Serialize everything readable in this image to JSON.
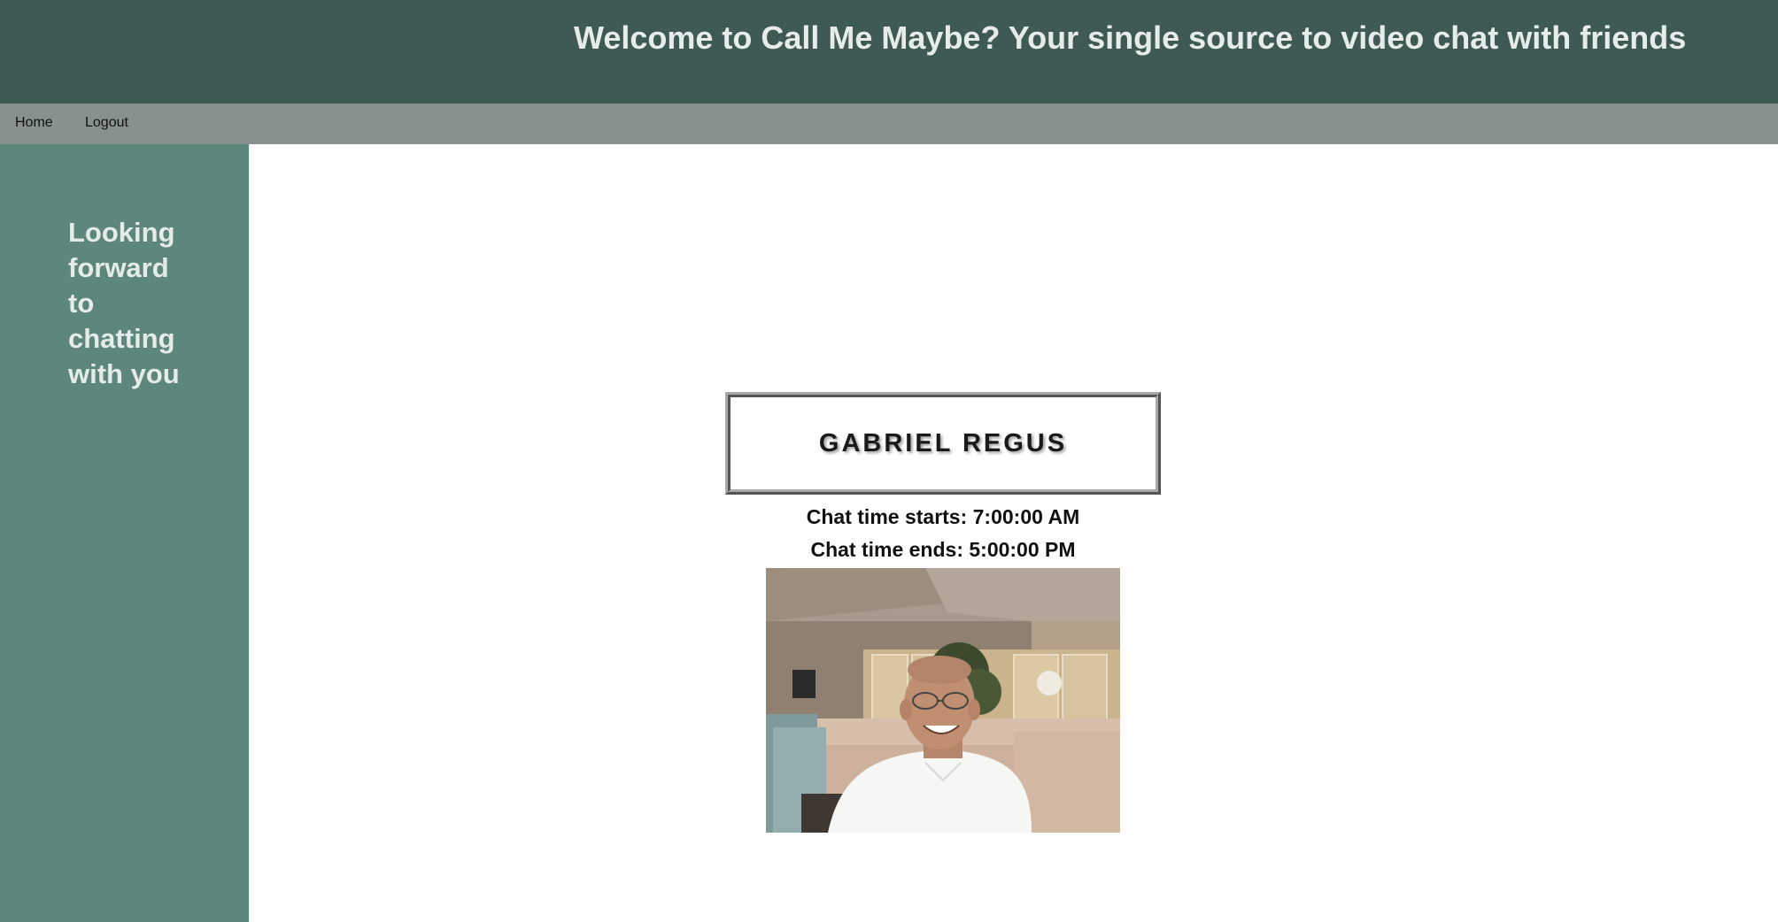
{
  "header": {
    "title": "Welcome to Call Me Maybe? Your single source to video chat with friends"
  },
  "nav": {
    "items": [
      {
        "label": "Home"
      },
      {
        "label": "Logout"
      }
    ]
  },
  "sidebar": {
    "message": "Looking forward to chatting with you"
  },
  "profile": {
    "name": "GABRIEL REGUS",
    "chat_start": "Chat time starts: 7:00:00 AM",
    "chat_end": "Chat time ends: 5:00:00 PM"
  },
  "colors": {
    "header_bg": "#3f5a54",
    "nav_bg": "#87928d",
    "sidebar_bg": "#5d877d",
    "header_text": "#e6ece9"
  }
}
